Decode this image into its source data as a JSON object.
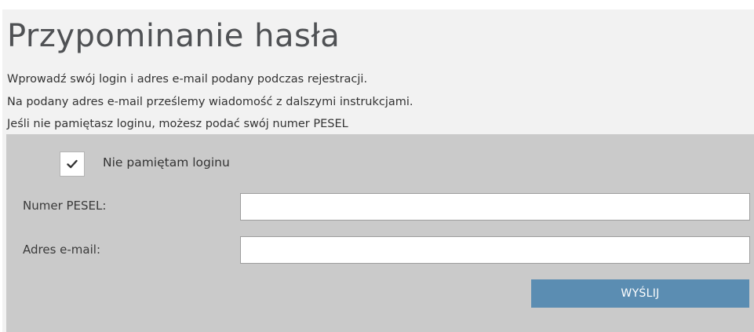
{
  "page": {
    "title": "Przypominanie hasła",
    "intro_lines": [
      "Wprowadź swój login i adres e-mail podany podczas rejestracji.",
      "Na podany adres e-mail prześlemy wiadomość z dalszymi instrukcjami.",
      "Jeśli nie pamiętasz loginu, możesz podać swój numer PESEL"
    ]
  },
  "form": {
    "forgot_login": {
      "label": "Nie pamiętam loginu",
      "checked": true,
      "icon": "checkmark-icon"
    },
    "fields": [
      {
        "label": "Numer PESEL:",
        "value": "",
        "placeholder": ""
      },
      {
        "label": "Adres e-mail:",
        "value": "",
        "placeholder": ""
      }
    ],
    "submit_label": "WYŚLIJ"
  },
  "colors": {
    "header_bg": "#f2f2f2",
    "form_bg": "#cacaca",
    "button_bg": "#5b8db2",
    "title_text": "#4f5154"
  }
}
